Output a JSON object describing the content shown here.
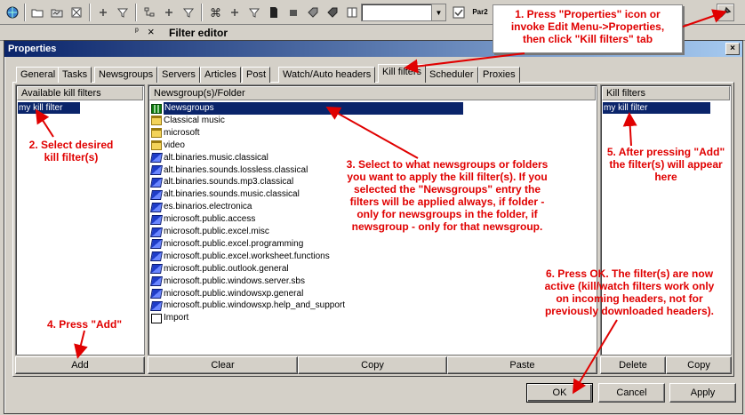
{
  "toolbar": {
    "icons": [
      "globe-icon",
      "new-folder-icon",
      "open-folder-icon",
      "delete-icon",
      "plus-icon",
      "filter-icon",
      "tree-icon",
      "plus-icon",
      "filter-icon",
      "command-icon",
      "plus-icon",
      "filter-icon",
      "document-icon",
      "square-icon",
      "tag-icon",
      "tag-icon",
      "book-icon"
    ],
    "right_icons": [
      "check-icon",
      "par2-icon",
      "properties-icon"
    ],
    "par2_label": "Par2"
  },
  "strip": {
    "pin": "ᵖ",
    "close": "×",
    "filter_editor_label": "Filter editor"
  },
  "dialog": {
    "title": "Properties",
    "close": "×"
  },
  "tabs": [
    {
      "label": "General"
    },
    {
      "label": "Tasks"
    },
    {
      "label": "Newsgroups"
    },
    {
      "label": "Servers"
    },
    {
      "label": "Articles"
    },
    {
      "label": "Post"
    },
    {
      "label": "Watch/Auto headers"
    },
    {
      "label": "Kill filters",
      "active": true
    },
    {
      "label": "Scheduler"
    },
    {
      "label": "Proxies"
    }
  ],
  "left_panel": {
    "header": "Available kill filters",
    "items": [
      "my kill filter"
    ],
    "add_button": "Add"
  },
  "middle_panel": {
    "header": "Newsgroup(s)/Folder",
    "items": [
      {
        "label": "Newsgroups",
        "icon": "root",
        "selected": true
      },
      {
        "label": "Classical music",
        "icon": "folder"
      },
      {
        "label": "microsoft",
        "icon": "folder"
      },
      {
        "label": "video",
        "icon": "folder"
      },
      {
        "label": "alt.binaries.music.classical",
        "icon": "group"
      },
      {
        "label": "alt.binaries.sounds.lossless.classical",
        "icon": "group"
      },
      {
        "label": "alt.binaries.sounds.mp3.classical",
        "icon": "group"
      },
      {
        "label": "alt.binaries.sounds.music.classical",
        "icon": "group"
      },
      {
        "label": "es.binarios.electronica",
        "icon": "group"
      },
      {
        "label": "microsoft.public.access",
        "icon": "group"
      },
      {
        "label": "microsoft.public.excel.misc",
        "icon": "group"
      },
      {
        "label": "microsoft.public.excel.programming",
        "icon": "group"
      },
      {
        "label": "microsoft.public.excel.worksheet.functions",
        "icon": "group"
      },
      {
        "label": "microsoft.public.outlook.general",
        "icon": "group"
      },
      {
        "label": "microsoft.public.windows.server.sbs",
        "icon": "group"
      },
      {
        "label": "microsoft.public.windowsxp.general",
        "icon": "group"
      },
      {
        "label": "microsoft.public.windowsxp.help_and_support",
        "icon": "group"
      },
      {
        "label": "Import",
        "icon": "import"
      }
    ],
    "clear_button": "Clear",
    "copy_button": "Copy",
    "paste_button": "Paste"
  },
  "right_panel": {
    "header": "Kill filters",
    "items": [
      "my kill filter"
    ],
    "delete_button": "Delete",
    "copy_button": "Copy"
  },
  "buttons": {
    "ok": "OK",
    "cancel": "Cancel",
    "apply": "Apply"
  },
  "annotations": {
    "step1": "1. Press \"Properties\" icon or\ninvoke Edit Menu->Properties,\nthen click \"Kill filters\" tab",
    "step2": "2. Select desired\nkill filter(s)",
    "step3": "3. Select to what newsgroups or folders\nyou want to apply the kill filter(s). If you\nselected the \"Newsgroups\" entry the\nfilters will be applied always, if folder -\nonly for newsgroups in the folder, if\nnewsgroup - only for that newsgroup.",
    "step4": "4. Press \"Add\"",
    "step5": "5. After pressing \"Add\"\nthe filter(s) will appear\nhere",
    "step6": "6. Press OK. The filter(s) are now\nactive (kill/watch filters work only\non incoming headers, not for\npreviously downloaded headers).",
    "color": "#e00000"
  }
}
